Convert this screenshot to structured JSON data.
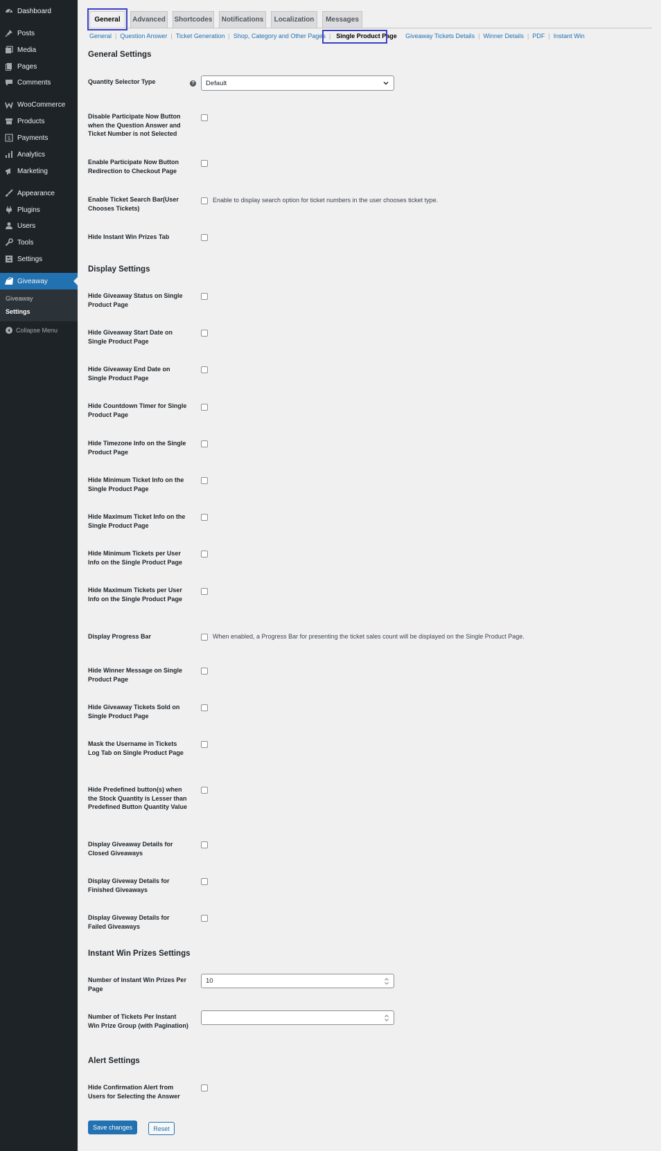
{
  "sidebar": {
    "items": [
      {
        "label": "Dashboard",
        "icon": "dashboard-icon"
      },
      {
        "label": "Posts",
        "icon": "pin-icon"
      },
      {
        "label": "Media",
        "icon": "media-icon"
      },
      {
        "label": "Pages",
        "icon": "pages-icon"
      },
      {
        "label": "Comments",
        "icon": "comment-icon"
      },
      {
        "label": "WooCommerce",
        "icon": "woocommerce-icon"
      },
      {
        "label": "Products",
        "icon": "archive-icon"
      },
      {
        "label": "Payments",
        "icon": "dollar-icon"
      },
      {
        "label": "Analytics",
        "icon": "chart-bar-icon"
      },
      {
        "label": "Marketing",
        "icon": "megaphone-icon"
      },
      {
        "label": "Appearance",
        "icon": "brush-icon"
      },
      {
        "label": "Plugins",
        "icon": "plugin-icon"
      },
      {
        "label": "Users",
        "icon": "user-icon"
      },
      {
        "label": "Tools",
        "icon": "wrench-icon"
      },
      {
        "label": "Settings",
        "icon": "settings-icon"
      },
      {
        "label": "Giveaway",
        "icon": "giveaway-icon"
      }
    ],
    "submenu": [
      "Giveaway",
      "Settings"
    ],
    "collapse_label": "Collapse Menu"
  },
  "tabs": [
    "General",
    "Advanced",
    "Shortcodes",
    "Notifications",
    "Localization",
    "Messages"
  ],
  "subnav": [
    "General",
    "Question Answer",
    "Ticket Generation",
    "Shop, Category and Other Pages",
    "Single Product Page",
    "Giveaway Tickets Details",
    "Winner Details",
    "PDF",
    "Instant Win"
  ],
  "sections": {
    "general": "General Settings",
    "display": "Display Settings",
    "instant": "Instant Win Prizes Settings",
    "alert": "Alert Settings"
  },
  "fields": {
    "quantity_selector": {
      "label": "Quantity Selector Type",
      "value": "Default"
    },
    "disable_participate": {
      "label": "Disable Participate Now Button when the Question Answer and Ticket Number is not Selected"
    },
    "enable_redirect": {
      "label": "Enable Participate Now Button Redirection to Checkout Page"
    },
    "ticket_search": {
      "label": "Enable Ticket Search Bar(User Chooses Tickets)",
      "desc": "Enable to display search option for ticket numbers in the user chooses ticket type."
    },
    "hide_instant_tab": {
      "label": "Hide Instant Win Prizes Tab"
    },
    "hide_status": {
      "label": "Hide Giveaway Status on Single Product Page"
    },
    "hide_start": {
      "label": "Hide Giveaway Start Date on Single Product Page"
    },
    "hide_end": {
      "label": "Hide Giveaway End Date on Single Product Page"
    },
    "hide_countdown": {
      "label": "Hide Countdown Timer for Single Product Page"
    },
    "hide_timezone": {
      "label": "Hide Timezone Info on the Single Product Page"
    },
    "hide_min_ticket": {
      "label": "Hide Minimum Ticket Info on the Single Product Page"
    },
    "hide_max_ticket": {
      "label": "Hide Maximum Ticket Info on the Single Product Page"
    },
    "hide_min_user": {
      "label": "Hide Minimum Tickets per User Info on the Single Product Page"
    },
    "hide_max_user": {
      "label": "Hide Maximum Tickets per User Info on the Single Product Page"
    },
    "progress_bar": {
      "label": "Display Progress Bar",
      "desc": "When enabled, a Progress Bar for presenting the ticket sales count will be displayed on the Single Product Page."
    },
    "hide_winner": {
      "label": "Hide Winner Message on Single Product Page"
    },
    "hide_sold": {
      "label": "Hide Giveaway Tickets Sold on Single Product Page"
    },
    "mask_username": {
      "label": "Mask the Username in Tickets Log Tab on Single Product Page"
    },
    "hide_predefined": {
      "label": "Hide Predefined button(s) when the Stock Quantity is Lesser than Predefined Button Quantity Value"
    },
    "closed": {
      "label": "Display Giveaway Details for Closed Giveaways"
    },
    "finished": {
      "label": "Display Giveway Details for Finished Giveaways"
    },
    "failed": {
      "label": "Display Giveway Details for Failed Giveaways"
    },
    "instant_per_page": {
      "label": "Number of Instant Win Prizes Per Page",
      "value": "10"
    },
    "tickets_per_group": {
      "label": "Number of Tickets Per Instant Win Prize Group (with Pagination)",
      "value": ""
    },
    "hide_confirm": {
      "label": "Hide Confirmation Alert from Users for Selecting the Answer"
    }
  },
  "buttons": {
    "save": "Save changes",
    "reset": "Reset"
  },
  "help_glyph": "?",
  "colors": {
    "accent": "#2271b1",
    "highlight": "#3b3fc4",
    "sidebar": "#1d2327"
  }
}
